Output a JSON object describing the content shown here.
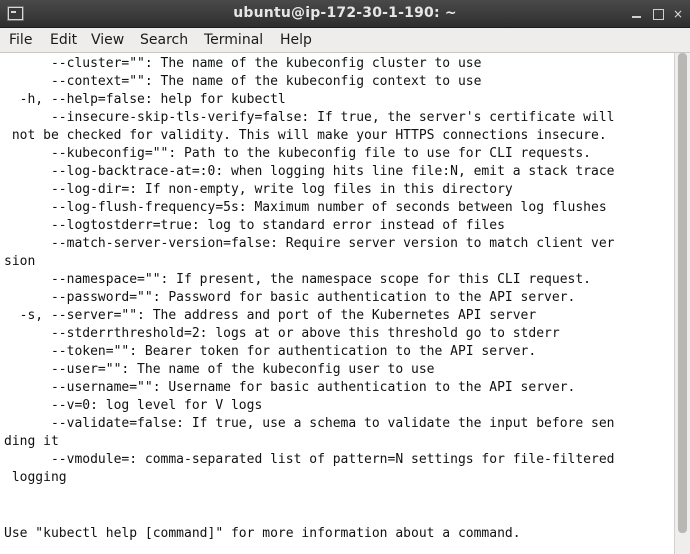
{
  "window": {
    "title": "ubuntu@ip-172-30-1-190: ~",
    "controls": {
      "minimize": "minimize-icon",
      "maximize": "maximize-icon",
      "close": "×"
    }
  },
  "menu": [
    "File",
    "Edit",
    "View",
    "Search",
    "Terminal",
    "Help"
  ],
  "terminal": {
    "lines": [
      "      --cluster=\"\": The name of the kubeconfig cluster to use",
      "      --context=\"\": The name of the kubeconfig context to use",
      "  -h, --help=false: help for kubectl",
      "      --insecure-skip-tls-verify=false: If true, the server's certificate will",
      " not be checked for validity. This will make your HTTPS connections insecure.",
      "      --kubeconfig=\"\": Path to the kubeconfig file to use for CLI requests.",
      "      --log-backtrace-at=:0: when logging hits line file:N, emit a stack trace",
      "      --log-dir=: If non-empty, write log files in this directory",
      "      --log-flush-frequency=5s: Maximum number of seconds between log flushes",
      "      --logtostderr=true: log to standard error instead of files",
      "      --match-server-version=false: Require server version to match client ver",
      "sion",
      "      --namespace=\"\": If present, the namespace scope for this CLI request.",
      "      --password=\"\": Password for basic authentication to the API server.",
      "  -s, --server=\"\": The address and port of the Kubernetes API server",
      "      --stderrthreshold=2: logs at or above this threshold go to stderr",
      "      --token=\"\": Bearer token for authentication to the API server.",
      "      --user=\"\": The name of the kubeconfig user to use",
      "      --username=\"\": Username for basic authentication to the API server.",
      "      --v=0: log level for V logs",
      "      --validate=false: If true, use a schema to validate the input before sen",
      "ding it",
      "      --vmodule=: comma-separated list of pattern=N settings for file-filtered",
      " logging",
      "",
      "",
      "Use \"kubectl help [command]\" for more information about a command."
    ]
  }
}
